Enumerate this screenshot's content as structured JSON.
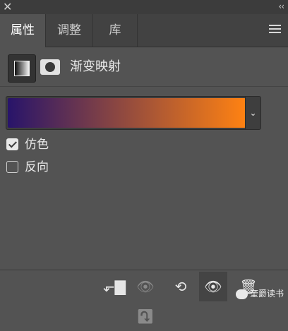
{
  "window": {
    "close_glyph": "✕",
    "collapse_glyph": "‹‹"
  },
  "tabs": [
    {
      "label": "属性",
      "active": true
    },
    {
      "label": "调整",
      "active": false
    },
    {
      "label": "库",
      "active": false
    }
  ],
  "panel": {
    "icon": "gradient-map-adjustment-icon",
    "mask_icon": "layer-mask-icon",
    "title": "渐变映射"
  },
  "gradient": {
    "start_color": "#28146a",
    "end_color": "#ff8212",
    "dropdown_glyph": "⌄"
  },
  "options": [
    {
      "label": "仿色",
      "checked": true
    },
    {
      "label": "反向",
      "checked": false
    }
  ],
  "footer": {
    "buttons": [
      {
        "icon": "clip-to-layer-icon",
        "glyph": "⬐▇"
      },
      {
        "icon": "view-previous-state-icon",
        "glyph": "👁⤵"
      },
      {
        "icon": "reset-icon",
        "glyph": "⟲"
      },
      {
        "icon": "visibility-eye-icon",
        "glyph": "👁"
      },
      {
        "icon": "trash-icon",
        "glyph": "🗑"
      }
    ]
  },
  "watermark": {
    "text": "奎爵读书"
  }
}
